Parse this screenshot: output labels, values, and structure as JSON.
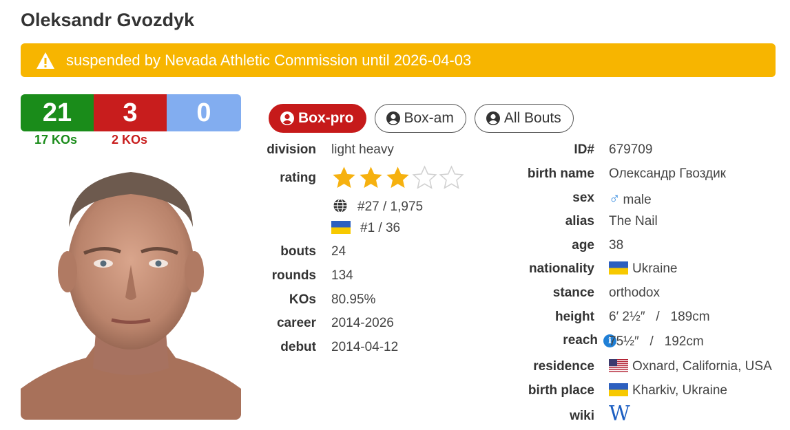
{
  "fighter": {
    "name": "Oleksandr Gvozdyk"
  },
  "alert": {
    "icon": "warning-icon",
    "text": "suspended by Nevada Athletic Commission until 2026-04-03",
    "color": "#f7b500"
  },
  "record": {
    "wins": "21",
    "losses": "3",
    "draws": "0",
    "wins_kos": "17 KOs",
    "losses_kos": "2 KOs",
    "colors": {
      "win": "#1a8c1a",
      "loss": "#c81d1d",
      "draw": "#82adf0"
    }
  },
  "tabs": [
    {
      "label": "Box-pro",
      "active": true
    },
    {
      "label": "Box-am",
      "active": false
    },
    {
      "label": "All Bouts",
      "active": false
    }
  ],
  "left": {
    "division": {
      "label": "division",
      "value": "light heavy"
    },
    "rating": {
      "label": "rating",
      "stars_filled": 3,
      "stars_total": 5,
      "world_rank": "#27 / 1,975",
      "country_rank": "#1 / 36"
    },
    "bouts": {
      "label": "bouts",
      "value": "24"
    },
    "rounds": {
      "label": "rounds",
      "value": "134"
    },
    "kos": {
      "label": "KOs",
      "value": "80.95%"
    },
    "career": {
      "label": "career",
      "value": "2014-2026"
    },
    "debut": {
      "label": "debut",
      "value": "2014-04-12"
    }
  },
  "right": {
    "id": {
      "label": "ID#",
      "value": "679709"
    },
    "birth_name": {
      "label": "birth name",
      "value": "Олександр Гвоздик"
    },
    "sex": {
      "label": "sex",
      "value": "male"
    },
    "alias": {
      "label": "alias",
      "value": "The Nail"
    },
    "age": {
      "label": "age",
      "value": "38"
    },
    "nationality": {
      "label": "nationality",
      "value": "Ukraine"
    },
    "stance": {
      "label": "stance",
      "value": "orthodox"
    },
    "height": {
      "label": "height",
      "value": "6′ 2½″   /   189cm"
    },
    "reach": {
      "label": "reach",
      "value": "75½″   /   192cm"
    },
    "residence": {
      "label": "residence",
      "value": "Oxnard, California, USA"
    },
    "birth_place": {
      "label": "birth place",
      "value": "Kharkiv, Ukraine"
    },
    "wiki": {
      "label": "wiki",
      "value": "W"
    }
  }
}
